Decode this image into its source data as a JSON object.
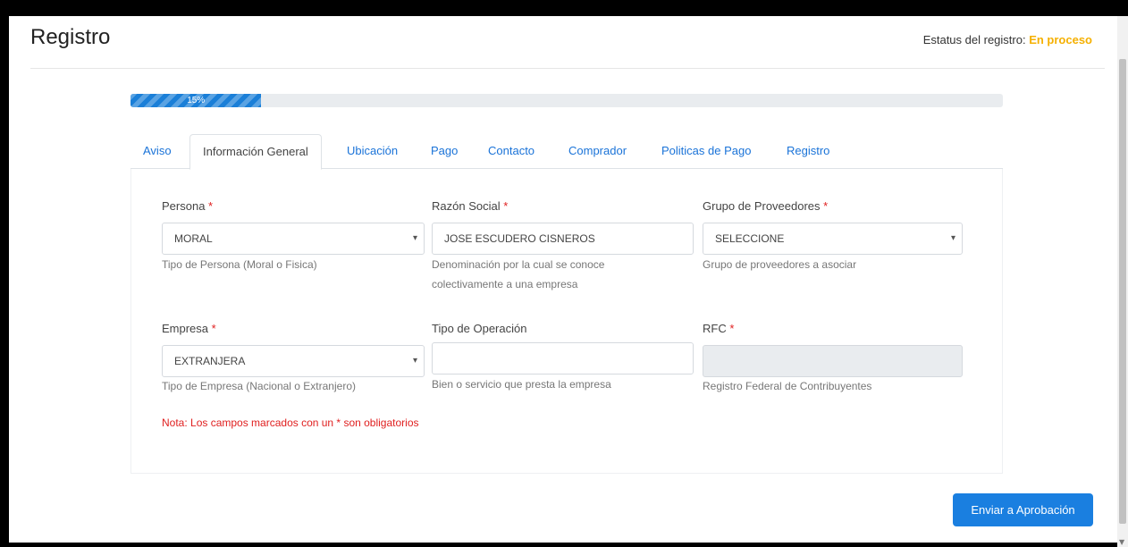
{
  "header": {
    "title": "Registro",
    "status_label": "Estatus del registro:",
    "status_value": "En proceso",
    "status_color": "#f5b000"
  },
  "progress": {
    "value": 0.15,
    "label": "15%"
  },
  "tabs": [
    {
      "label": "Aviso",
      "active": false
    },
    {
      "label": "Información General",
      "active": true
    },
    {
      "label": "Ubicación",
      "active": false
    },
    {
      "label": "Pago",
      "active": false
    },
    {
      "label": "Contacto",
      "active": false
    },
    {
      "label": "Comprador",
      "active": false
    },
    {
      "label": "Politicas de Pago",
      "active": false
    },
    {
      "label": "Registro",
      "active": false
    }
  ],
  "form": {
    "persona": {
      "label": "Persona",
      "required": "*",
      "value": "MORAL",
      "help": "Tipo de Persona (Moral o Fisica)"
    },
    "razon_social": {
      "label": "Razón Social",
      "required": "*",
      "value": "JOSE ESCUDERO CISNEROS",
      "help_line1": "Denominación por la cual se conoce",
      "help_line2": "colectivamente a una empresa"
    },
    "grupo": {
      "label": "Grupo de Proveedores",
      "required": "*",
      "value": "SELECCIONE",
      "help": "Grupo de proveedores a asociar"
    },
    "empresa": {
      "label": "Empresa",
      "required": "*",
      "value": "EXTRANJERA",
      "help": "Tipo de Empresa (Nacional o Extranjero)"
    },
    "tipo_operacion": {
      "label": "Tipo de Operación",
      "value": "",
      "help": "Bien o servicio que presta la empresa"
    },
    "rfc": {
      "label": "RFC",
      "required": "*",
      "value": "",
      "help": "Registro Federal de Contribuyentes"
    }
  },
  "note": "Nota: Los campos marcados con un * son obligatorios",
  "submit_label": "Enviar a Aprobación",
  "colors": {
    "primary": "#1a7fe0",
    "required": "#e02020",
    "accent": "#f5b000"
  }
}
